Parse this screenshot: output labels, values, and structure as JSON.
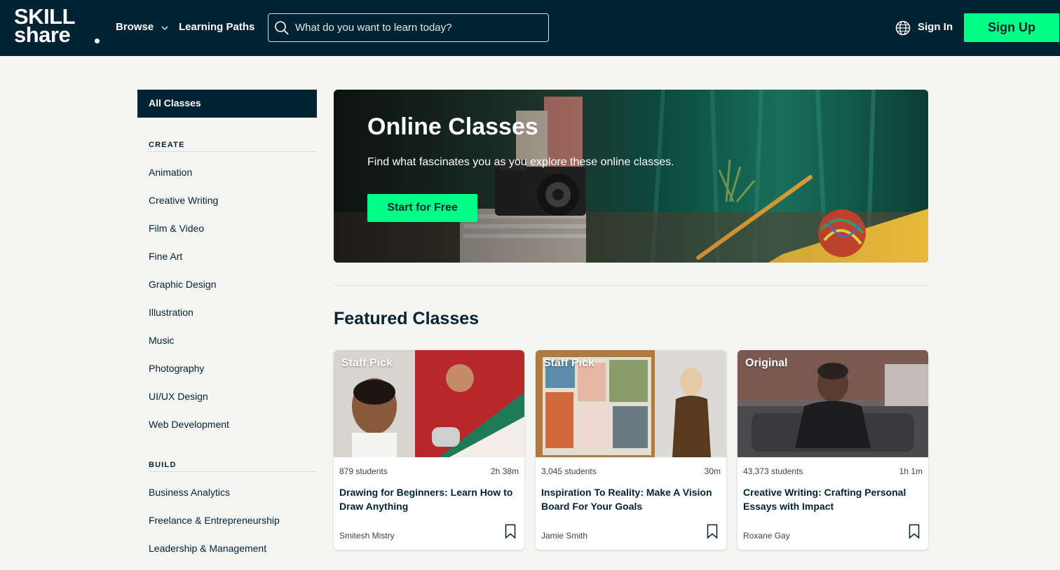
{
  "header": {
    "logo_line1": "SKILL",
    "logo_line2": "share",
    "browse_label": "Browse",
    "learning_paths_label": "Learning Paths",
    "search_placeholder": "What do you want to learn today?",
    "search_value": "",
    "sign_in_label": "Sign In",
    "sign_up_label": "Sign Up",
    "icons": [
      "chevron-down-icon",
      "search-icon",
      "globe-icon"
    ]
  },
  "sidebar": {
    "all_classes_label": "All Classes",
    "create_heading": "CREATE",
    "create_items": [
      "Animation",
      "Creative Writing",
      "Film & Video",
      "Fine Art",
      "Graphic Design",
      "Illustration",
      "Music",
      "Photography",
      "UI/UX Design",
      "Web Development"
    ],
    "build_heading": "BUILD",
    "build_items": [
      "Business Analytics",
      "Freelance & Entrepreneurship",
      "Leadership & Management"
    ]
  },
  "hero": {
    "title": "Online Classes",
    "subtitle": "Find what fascinates you as you explore these online classes.",
    "cta_label": "Start for Free"
  },
  "featured": {
    "title": "Featured Classes",
    "cards": [
      {
        "badge": "Staff Pick",
        "students": "879 students",
        "duration": "2h 38m",
        "title": "Drawing for Beginners: Learn How to Draw Anything",
        "teacher": "Smitesh Mistry"
      },
      {
        "badge": "Staff Pick",
        "students": "3,045 students",
        "duration": "30m",
        "title": "Inspiration To Reality: Make A Vision Board For Your Goals",
        "teacher": "Jamie Smith"
      },
      {
        "badge": "Original",
        "students": "43,373 students",
        "duration": "1h 1m",
        "title": "Creative Writing: Crafting Personal Essays with Impact",
        "teacher": "Roxane Gay"
      }
    ]
  },
  "colors": {
    "brand_dark": "#002333",
    "brand_green": "#00ff84",
    "page_bg": "#f5f5f4"
  }
}
